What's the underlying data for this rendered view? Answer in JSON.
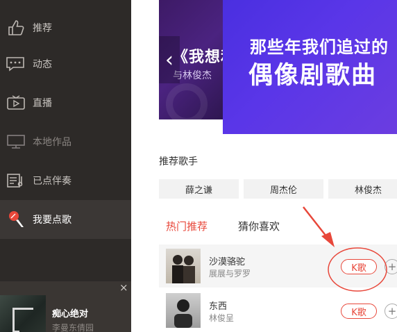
{
  "sidebar": {
    "items": [
      {
        "label": "推荐",
        "icon": "thumbs-up-icon"
      },
      {
        "label": "动态",
        "icon": "chat-bubble-icon"
      },
      {
        "label": "直播",
        "icon": "video-icon"
      },
      {
        "label": "本地作品",
        "icon": "monitor-icon"
      },
      {
        "label": "已点伴奏",
        "icon": "playlist-icon"
      },
      {
        "label": "我要点歌",
        "icon": "microphone-icon"
      }
    ]
  },
  "now_playing": {
    "title": "痴心绝对",
    "artist": "李曼东倩园",
    "close_label": "×"
  },
  "banner": {
    "left_title": "《我想和",
    "left_subtitle": "与林俊杰",
    "main_line1": "那些年我们追过的",
    "main_line2": "偶像剧歌曲",
    "prev_label": "‹"
  },
  "singers": {
    "title": "推荐歌手",
    "items": [
      "薛之谦",
      "周杰伦",
      "林俊杰"
    ]
  },
  "tabs": [
    {
      "label": "热门推荐",
      "active": true
    },
    {
      "label": "猜你喜欢",
      "active": false
    }
  ],
  "songs": [
    {
      "title": "沙漠骆驼",
      "artist": "展展与罗罗",
      "k_label": "K歌",
      "add_label": "+"
    },
    {
      "title": "东西",
      "artist": "林俊呈",
      "k_label": "K歌",
      "add_label": "+"
    }
  ],
  "colors": {
    "sidebar_bg": "#2d2a28",
    "accent": "#e8473a",
    "banner_purple": "#5a36e8"
  }
}
